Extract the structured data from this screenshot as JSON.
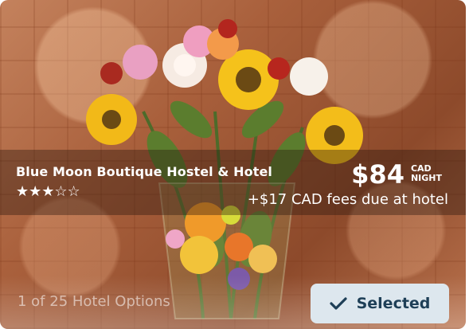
{
  "hotel": {
    "name": "Blue Moon Boutique Hostel & Hotel",
    "rating": 3,
    "rating_max": 5,
    "stars": "★★★☆☆"
  },
  "price": {
    "amount": "$84",
    "currency": "CAD",
    "period": "NIGHT",
    "fees": "+$17 CAD fees due at hotel"
  },
  "footer": {
    "options_count": "1 of 25 Hotel Options",
    "selected_label": "Selected"
  },
  "icons": {
    "check": "check-icon"
  },
  "colors": {
    "button_bg": "#dde7ee",
    "button_text": "#1e3f57",
    "band": "rgba(40,22,12,0.38)"
  }
}
